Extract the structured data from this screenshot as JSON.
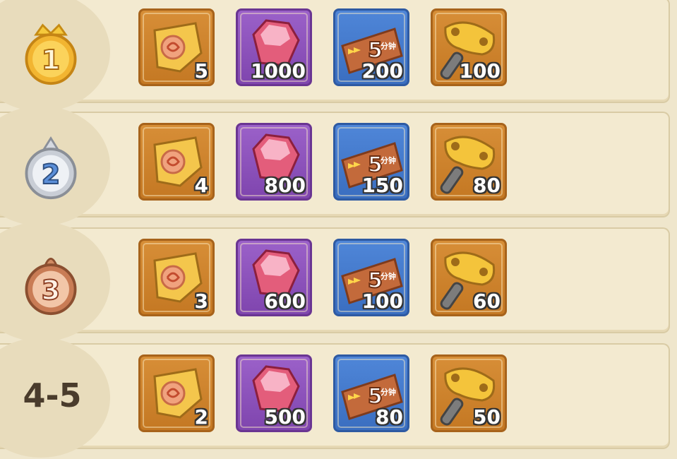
{
  "rewards": [
    {
      "rank": "1",
      "rank_type": "gold",
      "items": [
        {
          "icon": "scroll-icon",
          "qty": "5"
        },
        {
          "icon": "gem-icon",
          "qty": "1000"
        },
        {
          "icon": "ticket-icon",
          "qty": "200"
        },
        {
          "icon": "key-icon",
          "qty": "100"
        }
      ]
    },
    {
      "rank": "2",
      "rank_type": "silver",
      "items": [
        {
          "icon": "scroll-icon",
          "qty": "4"
        },
        {
          "icon": "gem-icon",
          "qty": "800"
        },
        {
          "icon": "ticket-icon",
          "qty": "150"
        },
        {
          "icon": "key-icon",
          "qty": "80"
        }
      ]
    },
    {
      "rank": "3",
      "rank_type": "bronze",
      "items": [
        {
          "icon": "scroll-icon",
          "qty": "3"
        },
        {
          "icon": "gem-icon",
          "qty": "600"
        },
        {
          "icon": "ticket-icon",
          "qty": "100"
        },
        {
          "icon": "key-icon",
          "qty": "60"
        }
      ]
    },
    {
      "rank": "4-5",
      "rank_type": "text",
      "items": [
        {
          "icon": "scroll-icon",
          "qty": "2"
        },
        {
          "icon": "gem-icon",
          "qty": "500"
        },
        {
          "icon": "ticket-icon",
          "qty": "80"
        },
        {
          "icon": "key-icon",
          "qty": "50"
        }
      ]
    }
  ],
  "ticket_label": {
    "minutes": "5",
    "unit": "分钟"
  },
  "colors": {
    "gold": "#f2b531",
    "silver": "#c9ced6",
    "bronze": "#c97c55",
    "text": "#4a3c2c"
  }
}
